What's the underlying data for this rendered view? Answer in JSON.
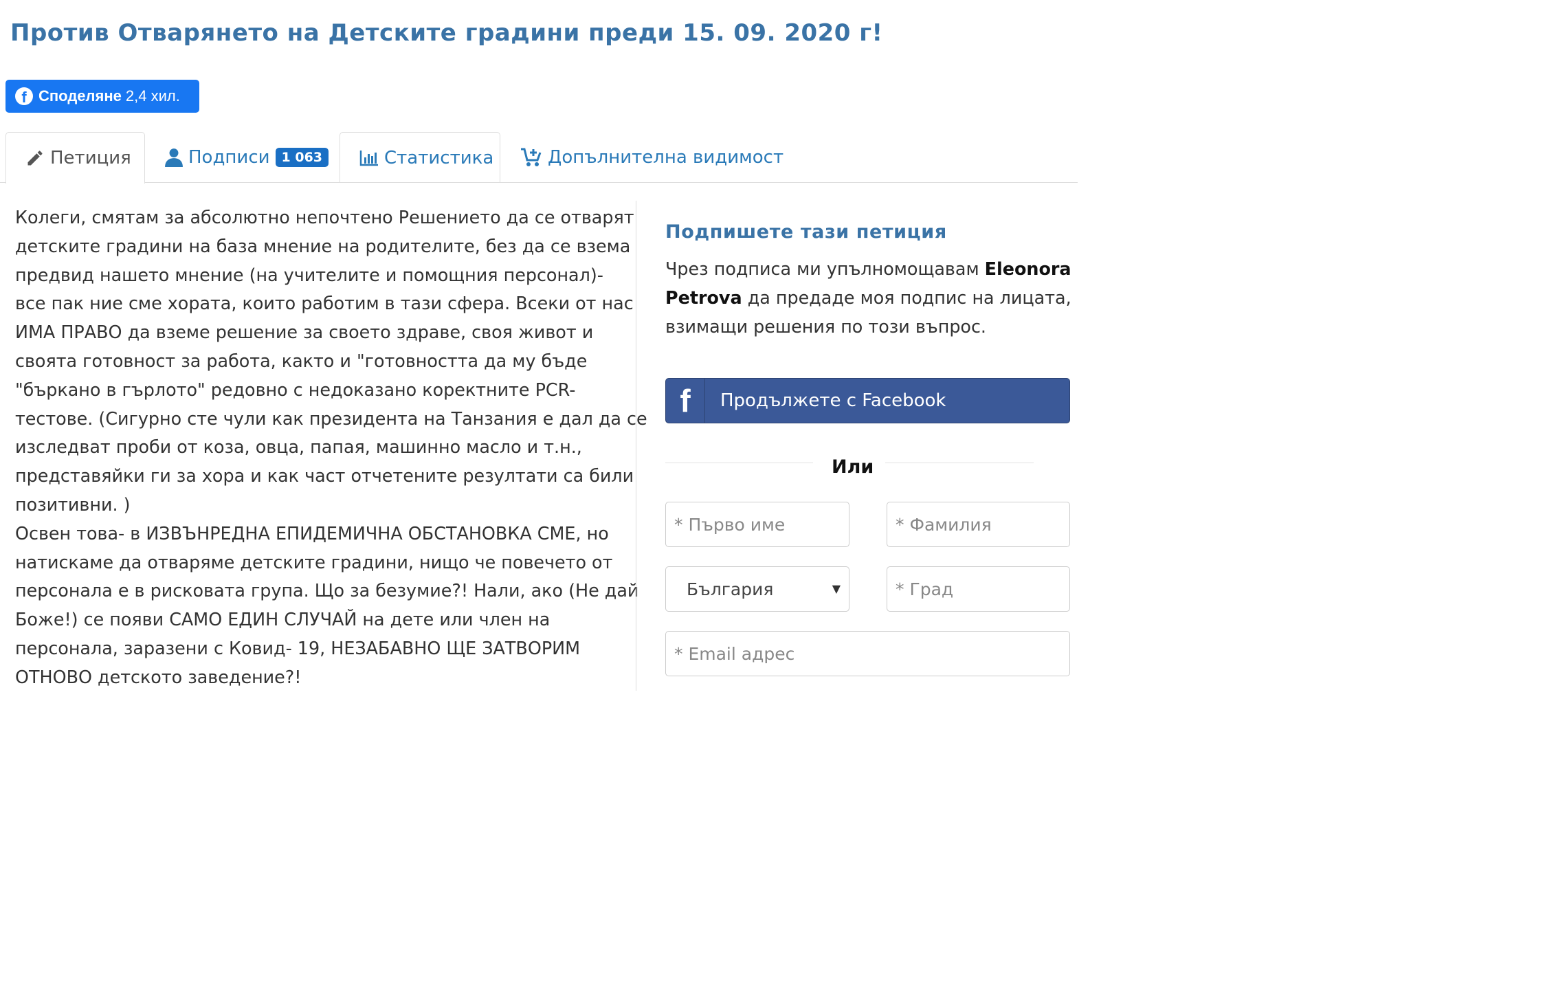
{
  "page": {
    "title": "Против Отварянето на Детските градини преди 15. 09. 2020 г!"
  },
  "share": {
    "label": "Споделяне",
    "count": "2,4 хил."
  },
  "tabs": [
    {
      "label": "Петиция",
      "icon": "pencil-icon",
      "active": true
    },
    {
      "label": "Подписи",
      "icon": "user-icon",
      "badge": "1 063"
    },
    {
      "label": "Статистика",
      "icon": "bar-chart-icon"
    },
    {
      "label": "Допълнителна видимост",
      "icon": "cart-plus-icon"
    }
  ],
  "petition": {
    "lines": [
      "Колеги, смятам за абсолютно непочтено Решението да се отварят",
      "детските градини на база мнение на родителите, без да се взема",
      "предвид нашето мнение (на учителите и помощния персонал)-",
      "все пак ние сме хората, които работим в тази сфера. Всеки от нас",
      "ИМА ПРАВО да вземе решение за своето здраве, своя живот и",
      "своята готовност за работа, както и \"готовността да му бъде",
      "\"бъркано в гърлото\" редовно с недоказано коректните PCR-",
      "тестове. (Сигурно сте чули как президента на Танзания е дал да се",
      "изследват проби от коза, овца, папая, машинно масло и т.н.,",
      "представяйки ги за хора и как част отчетените резултати са били",
      "позитивни. )",
      "Освен това- в ИЗВЪНРЕДНА ЕПИДЕМИЧНА ОБСТАНОВКА СМЕ, но",
      "натискаме да отваряме детските градини, нищо че повечето от",
      "персонала е в рисковата група. Що за безумие?! Нали, ако (Не дай",
      "Боже!) се появи САМО ЕДИН СЛУЧАЙ на дете или член на",
      "персонала, заразени с Ковид- 19, НЕЗАБАВНО ЩЕ ЗАТВОРИМ",
      "ОТНОВО детското заведение?!"
    ]
  },
  "sign": {
    "heading": "Подпишете тази петиция",
    "text_1": "Чрез подписа ми упълномощавам ",
    "author_first": "Eleonora",
    "author_last": "Petrova",
    "text_2": " да предаде моя подпис на лицата,",
    "text_3": "взимащи решения по този въпрос.",
    "facebook_button": "Продължете с Facebook",
    "or_label": "Или",
    "first_name_placeholder": "* Първо име",
    "last_name_placeholder": "* Фамилия",
    "country_value": "България",
    "city_placeholder": "* Град",
    "email_placeholder": "* Email адрес"
  },
  "colors": {
    "title": "#3a73a6",
    "facebook_share": "#1877f2",
    "facebook_continue": "#3b5998",
    "badge": "#1a6fc4",
    "link": "#2a7ab8"
  }
}
